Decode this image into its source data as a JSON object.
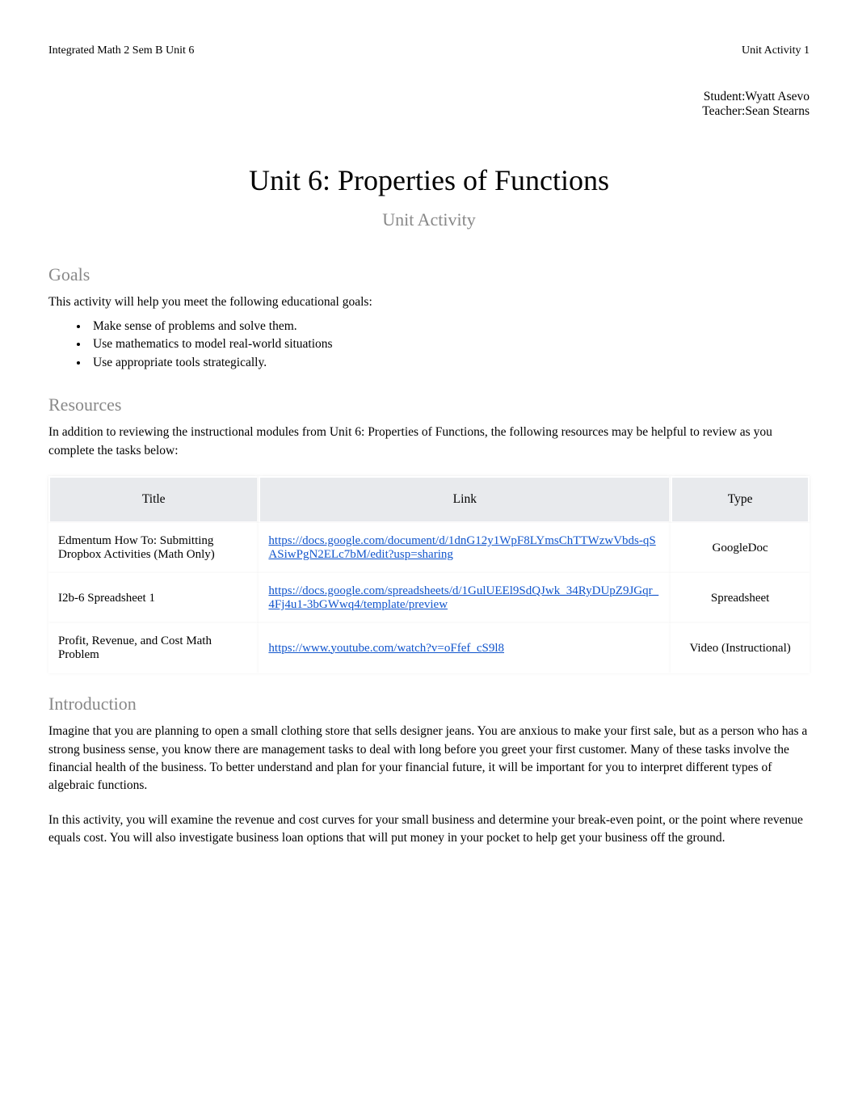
{
  "header": {
    "left": "Integrated Math 2 Sem B Unit 6",
    "right": "Unit Activity 1"
  },
  "meta": {
    "student_label": "Student:",
    "student_name": "Wyatt Asevo",
    "teacher_label": "Teacher:",
    "teacher_name": "Sean Stearns"
  },
  "title": "Unit 6: Properties of Functions",
  "subtitle": "Unit Activity",
  "goals": {
    "heading": "Goals",
    "intro": "This activity will help you meet the following educational goals:",
    "items": [
      "Make sense of problems and solve them.",
      "Use mathematics to model real-world situations",
      "Use appropriate tools strategically."
    ]
  },
  "resources": {
    "heading": "Resources",
    "intro_part1": "In addition to reviewing the instructional modules from ",
    "intro_unit": "Unit 6: Properties of Functions",
    "intro_part2": ", the following resources may be helpful to review as you complete the tasks below:",
    "columns": {
      "title": "Title",
      "link": "Link",
      "type": "Type"
    },
    "rows": [
      {
        "title": "Edmentum How To: Submitting Dropbox Activities (Math Only)",
        "link": "https://docs.google.com/document/d/1dnG12y1WpF8LYmsChTTWzwVbds-qSASiwPgN2ELc7bM/edit?usp=sharing",
        "type": "GoogleDoc"
      },
      {
        "title": "I2b-6 Spreadsheet 1",
        "link": "https://docs.google.com/spreadsheets/d/1GulUEEl9SdQJwk_34RyDUpZ9JGqr_4Fj4u1-3bGWwq4/template/preview",
        "type": "Spreadsheet"
      },
      {
        "title": "Profit, Revenue, and Cost Math Problem",
        "link": "https://www.youtube.com/watch?v=oFfef_cS9l8",
        "type": "Video (Instructional)"
      }
    ]
  },
  "introduction": {
    "heading": "Introduction",
    "p1": "Imagine that you are planning to open a small clothing store that sells designer jeans. You are anxious to make your first sale, but as a person who has a strong business sense, you know there are management tasks to deal with long before you greet your first customer. Many of these tasks involve the financial health of the business. To better understand and plan for your financial future, it will be important for you to interpret different types of algebraic functions.",
    "p2_a": "In this activity, you will ",
    "p2_b": "examine the revenue and cost curves",
    "p2_c": " for your small business and determine your ",
    "p2_d": "break-even point",
    "p2_e": ", or the point where revenue equals cost. You will also investigate ",
    "p2_f": "business loan options",
    "p2_g": " that will put money in your pocket to help get your business off the ground."
  }
}
